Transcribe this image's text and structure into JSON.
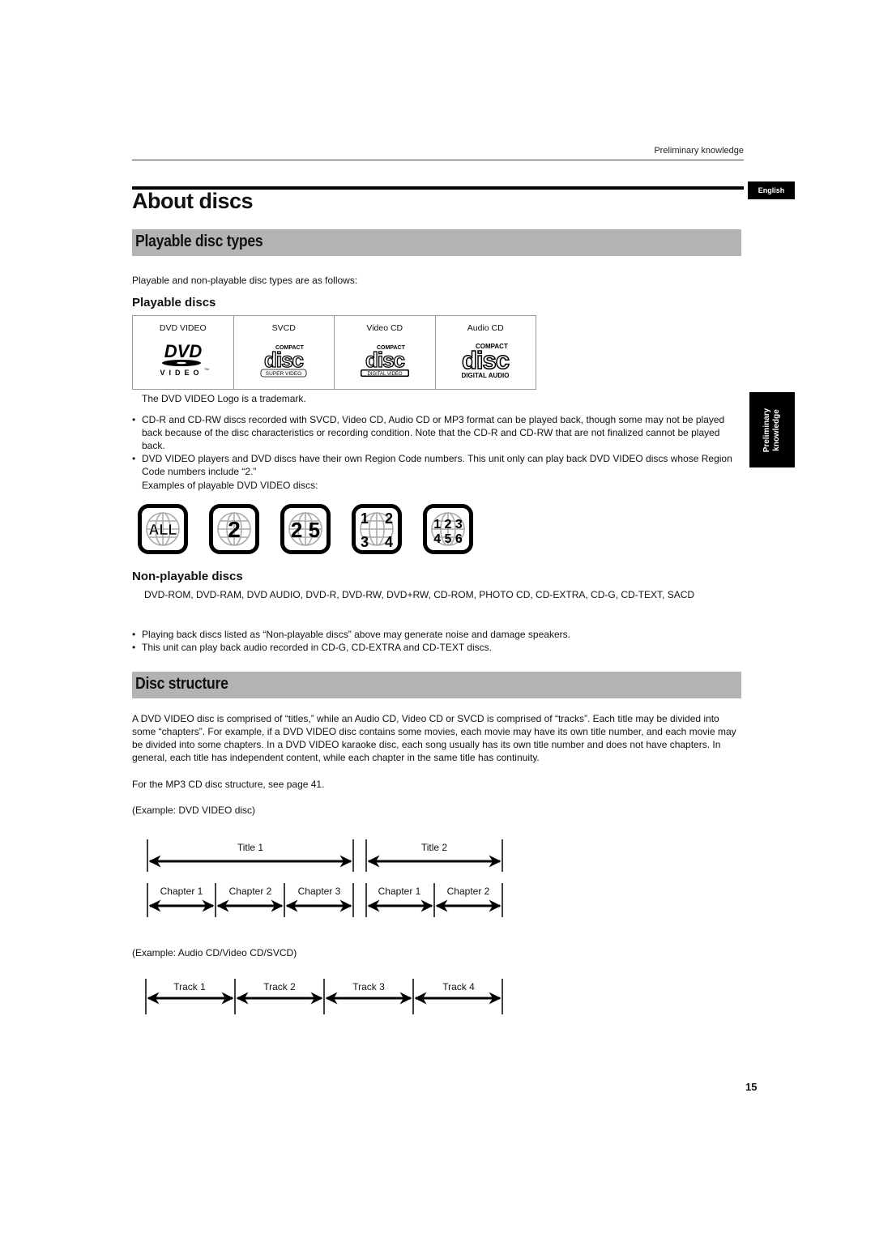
{
  "header": {
    "running_head": "Preliminary knowledge",
    "language_tab": "English",
    "side_tab_line1": "Preliminary",
    "side_tab_line2": "knowledge"
  },
  "page_title": "About discs",
  "sections": {
    "playable_types": {
      "heading": "Playable disc types",
      "intro": "Playable and non-playable disc types are as follows:",
      "playable_heading": "Playable discs",
      "disc_table": [
        {
          "label": "DVD VIDEO",
          "logo": "dvd-video-logo"
        },
        {
          "label": "SVCD",
          "logo": "compact-disc-super-video-logo",
          "logo_caption": "SUPER VIDEO"
        },
        {
          "label": "Video CD",
          "logo": "compact-disc-digital-video-logo",
          "logo_caption": "DIGITAL VIDEO"
        },
        {
          "label": "Audio CD",
          "logo": "compact-disc-digital-audio-logo",
          "logo_caption": "DIGITAL AUDIO"
        }
      ],
      "logo_words": {
        "compact": "COMPACT",
        "disc": "disc",
        "video": "VIDEO",
        "dvd": "DVD",
        "tm": "TM"
      },
      "trademark_note": "The DVD VIDEO Logo is a trademark.",
      "bullets": [
        "CD-R and CD-RW discs recorded with SVCD, Video CD, Audio CD or MP3 format can be played back, though some may not be played back because of the disc characteristics or recording condition. Note that the CD-R and CD-RW that are not finalized cannot be played back.",
        "DVD VIDEO players and DVD discs have their own Region Code numbers. This unit only can play back DVD VIDEO discs whose Region Code numbers include “2.”"
      ],
      "examples_label": "Examples of playable DVD VIDEO discs:",
      "region_codes": [
        {
          "text": [
            "ALL"
          ]
        },
        {
          "text": [
            "2"
          ]
        },
        {
          "text": [
            "2 5"
          ]
        },
        {
          "text": [
            "1",
            "2",
            "3",
            "4"
          ]
        },
        {
          "text": [
            "1 2 3",
            "4 5 6"
          ]
        }
      ],
      "non_playable_heading": "Non-playable discs",
      "non_playable_list": "DVD-ROM, DVD-RAM, DVD AUDIO, DVD-R, DVD-RW, DVD+RW, CD-ROM, PHOTO CD, CD-EXTRA, CD-G, CD-TEXT, SACD",
      "notes": [
        "Playing back discs listed as “Non-playable discs” above may generate noise and damage speakers.",
        "This unit can play back audio recorded in CD-G, CD-EXTRA and CD-TEXT discs."
      ]
    },
    "disc_structure": {
      "heading": "Disc structure",
      "paragraph": "A DVD VIDEO disc is comprised of “titles,” while an Audio CD, Video CD or SVCD is comprised of “tracks”. Each title may be divided into some “chapters”. For example, if a DVD VIDEO disc contains some movies, each movie may have its own title number, and each movie may be divided into some chapters. In a DVD VIDEO karaoke disc, each song usually has its own title number and does not have chapters. In general, each title has independent content, while each chapter in the same title has continuity.",
      "mp3_note": "For the MP3 CD disc structure, see page 41.",
      "dvd_example_label": "(Example: DVD VIDEO disc)",
      "titles": [
        "Title 1",
        "Title 2"
      ],
      "chapters": [
        "Chapter 1",
        "Chapter 2",
        "Chapter 3",
        "Chapter 1",
        "Chapter 2"
      ],
      "cd_example_label": "(Example: Audio CD/Video CD/SVCD)",
      "tracks": [
        "Track 1",
        "Track 2",
        "Track 3",
        "Track 4"
      ]
    }
  },
  "page_number": "15"
}
